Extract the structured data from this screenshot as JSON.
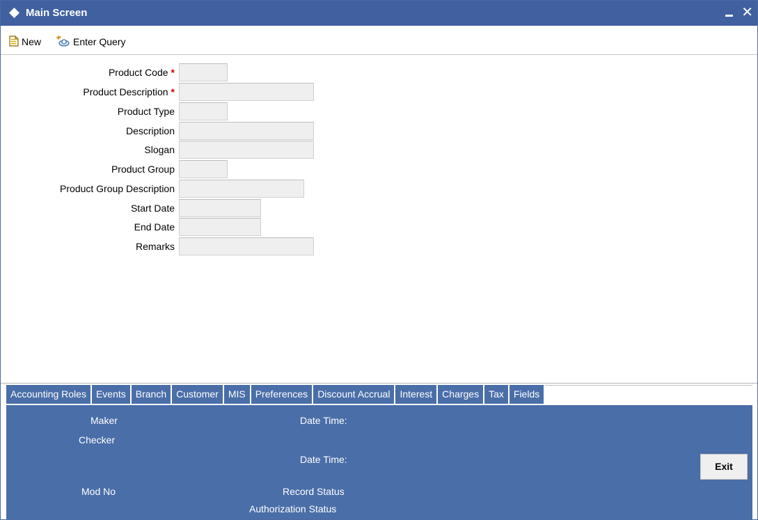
{
  "window": {
    "title": "Main Screen"
  },
  "toolbar": {
    "new_label": "New",
    "enter_query_label": "Enter Query"
  },
  "form": {
    "fields": [
      {
        "label": "Product Code",
        "required": "*",
        "value": ""
      },
      {
        "label": "Product Description",
        "required": "*",
        "value": ""
      },
      {
        "label": "Product Type",
        "required": "",
        "value": ""
      },
      {
        "label": "Description",
        "required": "",
        "value": ""
      },
      {
        "label": "Slogan",
        "required": "",
        "value": ""
      },
      {
        "label": "Product Group",
        "required": "",
        "value": ""
      },
      {
        "label": "Product Group Description",
        "required": "",
        "value": ""
      },
      {
        "label": "Start Date",
        "required": "",
        "value": ""
      },
      {
        "label": "End Date",
        "required": "",
        "value": ""
      },
      {
        "label": "Remarks",
        "required": "",
        "value": ""
      }
    ]
  },
  "tabs": [
    "Accounting Roles",
    "Events",
    "Branch",
    "Customer",
    "MIS",
    "Preferences",
    "Discount Accrual",
    "Interest",
    "Charges",
    "Tax",
    "Fields"
  ],
  "footer": {
    "maker_label": "Maker",
    "checker_label": "Checker",
    "maker_datetime_label": "Date Time:",
    "checker_datetime_label": "Date Time:",
    "mod_no_label": "Mod No",
    "record_status_label": "Record Status",
    "authorization_status_label": "Authorization Status",
    "exit_label": "Exit"
  },
  "colors": {
    "titlebar": "#4060a0",
    "tab_and_footer": "#4a6ea8",
    "required_marker": "#d10000"
  }
}
